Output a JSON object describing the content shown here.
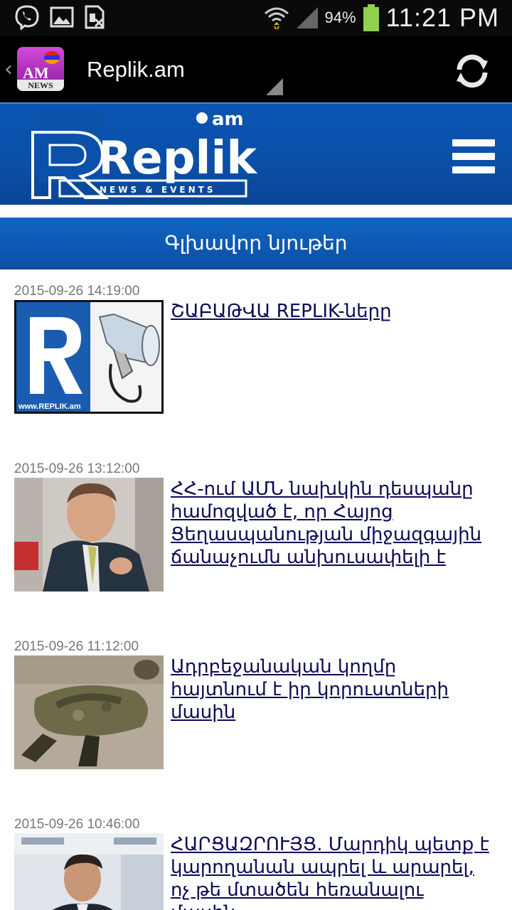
{
  "status_bar": {
    "battery_percent": "94%",
    "time": "11:21 PM",
    "icons": [
      "viber-icon",
      "image-icon",
      "sim-icon",
      "wifi-icon",
      "signal-icon",
      "battery-icon"
    ]
  },
  "action_bar": {
    "app_icon": {
      "flag_colors": [
        "#dd2222",
        "#2233dd",
        "#ff9900"
      ],
      "text_top": "AM",
      "text_bottom": "NEWS"
    },
    "title": "Replik.am",
    "refresh_icon": "refresh-icon"
  },
  "banner": {
    "logo_word": "Replik",
    "logo_suffix": "am",
    "logo_tagline": "NEWS & EVENTS",
    "menu_icon": "hamburger-icon",
    "background": "#0b4fa6"
  },
  "section": {
    "title": "Գլխավոր նյութեր"
  },
  "articles": [
    {
      "date": "2015-09-26 14:19:00",
      "title": "ՇԱԲԱԹՎԱ REPLIK-ները",
      "thumb": "replik-megaphone"
    },
    {
      "date": "2015-09-26 13:12:00",
      "title": "ՀՀ-ում ԱՄՆ նախկին դեսպանը համոզված է, որ Հայոց Ցեղասպանության միջազգային ճանաչումն անխուսափելի է",
      "thumb": "man-speaking"
    },
    {
      "date": "2015-09-26 11:12:00",
      "title": "Ադրբեջանական կողմը հայտնում է իր կորուստների մասին",
      "thumb": "soldier-ground"
    },
    {
      "date": "2015-09-26 10:46:00",
      "title": "ՀԱՐՑԱԶՐՈՒՅՑ. Մարդիկ պետք է կարողանան ապրել և արարել, ոչ թե մտածեն հեռանալու մասին.",
      "thumb": "man-press"
    }
  ]
}
